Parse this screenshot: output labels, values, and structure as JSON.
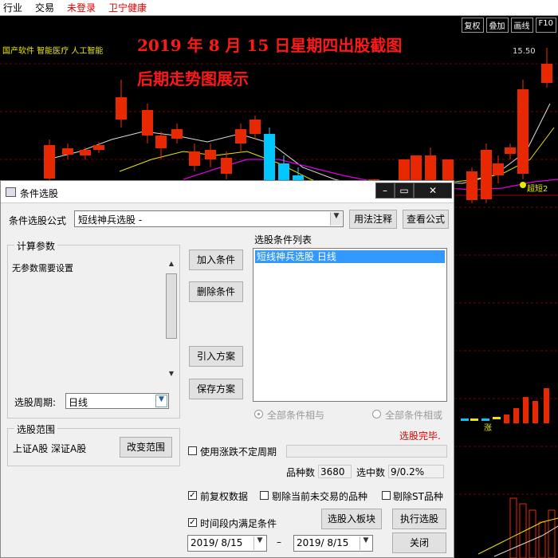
{
  "topbar": {
    "industry": "行业",
    "trade": "交易",
    "login": "未登录",
    "stock": "卫宁健康"
  },
  "chart": {
    "title": "2019 年 8 月 15 日星期四出股截图",
    "subtitle": "后期走势图展示",
    "concepts": "国产软件 智能医疗 人工智能",
    "price_label": "15.50",
    "indicator_label": "超短2",
    "zhang_label": "涨",
    "buttons": [
      "复权",
      "叠加",
      "画线",
      "F10"
    ]
  },
  "dialog": {
    "title": "条件选股",
    "formula_label": "条件选股公式",
    "formula_value": "短线神兵选股 -",
    "usage_btn": "用法注释",
    "view_btn": "查看公式",
    "calc_group": "计算参数",
    "no_params": "无参数需要设置",
    "period_label": "选股周期:",
    "period_value": "日线",
    "add_btn": "加入条件",
    "delete_btn": "删除条件",
    "import_btn": "引入方案",
    "save_btn": "保存方案",
    "list_label": "选股条件列表",
    "list_items": [
      "短线神兵选股   日线"
    ],
    "radio_and": "全部条件相与",
    "radio_or": "全部条件相或",
    "done_text": "选股完毕.",
    "range_group": "选股范围",
    "range_value": "上证A股  深证A股",
    "change_range_btn": "改变范围",
    "use_period_label": "使用涨跌不定周期",
    "count_label": "品种数",
    "count_value": "3680",
    "selected_label": "选中数",
    "selected_value": "9/0.2%",
    "pre_adjust_label": "前复权数据",
    "exclude_untraded_label": "剔除当前未交易的品种",
    "exclude_st_label": "剔除ST品种",
    "time_cond_label": "时间段内满足条件",
    "to_block_btn": "选股入板块",
    "run_btn": "执行选股",
    "close_btn": "关闭",
    "date_from": "2019/ 8/15",
    "date_to": "2019/ 8/15",
    "date_sep": "–"
  }
}
